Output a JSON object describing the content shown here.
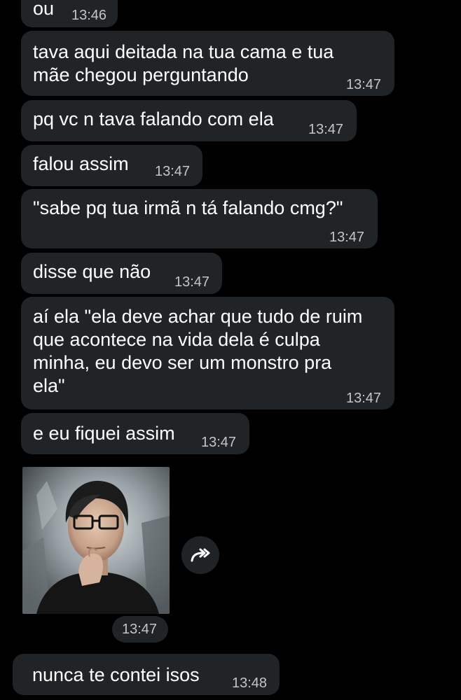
{
  "messages": [
    {
      "id": "m0",
      "text": "ou",
      "time": "13:46"
    },
    {
      "id": "m1",
      "text": "tava aqui deitada na tua cama e tua\nmãe chegou perguntando",
      "time": "13:47"
    },
    {
      "id": "m2",
      "text": "pq vc n tava falando com ela",
      "time": "13:47"
    },
    {
      "id": "m3",
      "text": "falou assim",
      "time": "13:47"
    },
    {
      "id": "m4",
      "text": "\"sabe pq tua irmã n tá falando cmg?\"",
      "time": "13:47"
    },
    {
      "id": "m5",
      "text": "disse que não",
      "time": "13:47"
    },
    {
      "id": "m6",
      "text": "aí ela \"ela deve achar que tudo de ruim\nque acontece na vida dela é culpa\nminha, eu devo ser um monstro pra\nela\"",
      "time": "13:47"
    },
    {
      "id": "m7",
      "text": "e eu fiquei assim",
      "time": "13:47"
    },
    {
      "id": "m8",
      "text": "nunca te contei isos",
      "time": "13:48"
    }
  ],
  "photo_message": {
    "time": "13:47",
    "forward_icon": "forward-arrow-icon"
  },
  "colors": {
    "background": "#000000",
    "bubble": "#202427",
    "text": "#ffffff",
    "time": "#c2c6ca"
  }
}
